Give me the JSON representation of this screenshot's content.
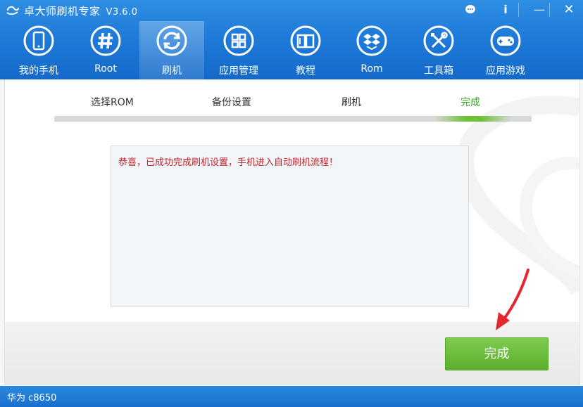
{
  "app": {
    "title": "卓大师刷机专家",
    "version": "V3.6.0"
  },
  "window_controls": {
    "chat_icon": "chat-bubble-icon",
    "info": "i",
    "minimize": "—",
    "close": "✕"
  },
  "nav": {
    "items": [
      {
        "label": "我的手机",
        "icon": "phone-icon"
      },
      {
        "label": "Root",
        "icon": "hash-icon"
      },
      {
        "label": "刷机",
        "icon": "refresh-icon",
        "active": true
      },
      {
        "label": "应用管理",
        "icon": "grid-icon"
      },
      {
        "label": "教程",
        "icon": "book-icon"
      },
      {
        "label": "Rom",
        "icon": "dropbox-icon"
      },
      {
        "label": "工具箱",
        "icon": "tools-icon"
      },
      {
        "label": "应用游戏",
        "icon": "gamepad-icon"
      }
    ]
  },
  "steps": {
    "items": [
      "选择ROM",
      "备份设置",
      "刷机",
      "完成"
    ],
    "current": "完成",
    "progress_fraction": 1.0
  },
  "log": {
    "message": "恭喜，已成功完成刷机设置，手机进入自动刷机流程！"
  },
  "actions": {
    "finish_label": "完成"
  },
  "status": {
    "device": "华为 c8650"
  },
  "colors": {
    "brand_blue": "#1f7bd9",
    "success_green": "#5cb02d",
    "message_red": "#c8212b",
    "annotation_red": "#e5262e"
  }
}
